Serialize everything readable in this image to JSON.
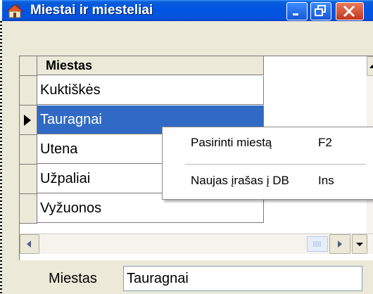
{
  "window": {
    "title": "Miestai ir miesteliai"
  },
  "grid": {
    "column_header": "Miestas",
    "rows": [
      "Kuktiškės",
      "Tauragnai",
      "Utena",
      "Užpaliai",
      "Vyžuonos"
    ],
    "selected_index": 1
  },
  "context_menu": {
    "items": [
      {
        "label": "Pasirinti miestą",
        "shortcut": "F2"
      },
      {
        "label": "Naujas įrašas į DB",
        "shortcut": "Ins"
      }
    ]
  },
  "form": {
    "city_label": "Miestas",
    "city_value": "Tauragnai"
  },
  "colors": {
    "title_bar": "#0054e3",
    "selection": "#316ac5",
    "window_bg": "#ece9d8",
    "close_button": "#c1371c"
  }
}
